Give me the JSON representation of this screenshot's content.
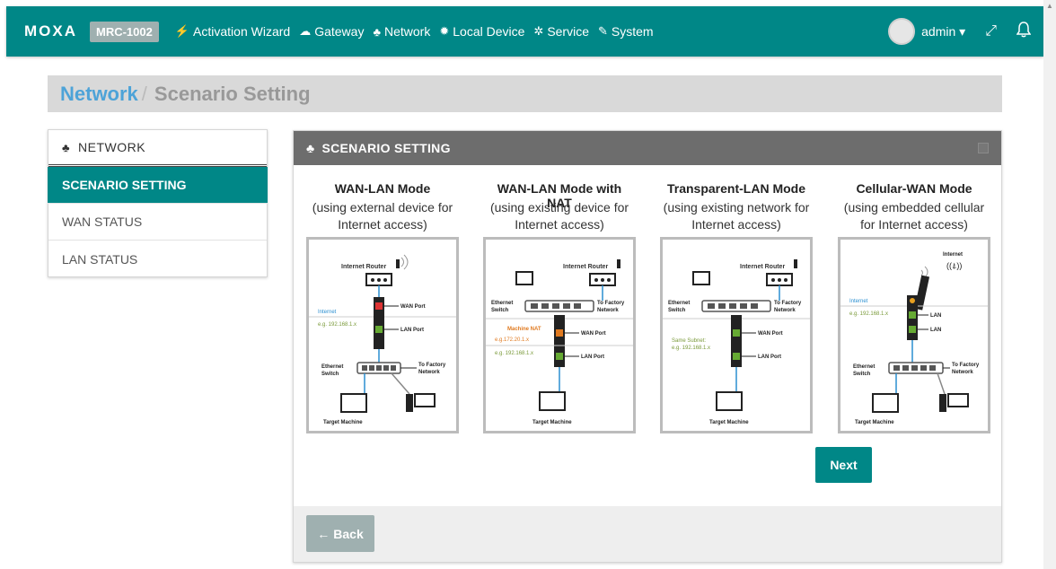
{
  "header": {
    "logo": "MOXA",
    "model": "MRC-1002",
    "nav": [
      {
        "label": "Activation Wizard",
        "icon": "wand-icon"
      },
      {
        "label": "Gateway",
        "icon": "cloud-icon"
      },
      {
        "label": "Network",
        "icon": "sitemap-icon"
      },
      {
        "label": "Local Device",
        "icon": "gear-icon"
      },
      {
        "label": "Service",
        "icon": "gears-icon"
      },
      {
        "label": "System",
        "icon": "wrench-icon"
      }
    ],
    "user": "admin"
  },
  "breadcrumb": {
    "parent": "Network",
    "separator": "/",
    "current": "Scenario Setting"
  },
  "sidebar": {
    "title": "NETWORK",
    "items": [
      {
        "label": "SCENARIO SETTING",
        "active": true
      },
      {
        "label": "WAN STATUS",
        "active": false
      },
      {
        "label": "LAN STATUS",
        "active": false
      }
    ]
  },
  "panel": {
    "title": "SCENARIO SETTING",
    "modes": [
      {
        "title": "WAN-LAN Mode",
        "subtitle_line1": "(using external device for",
        "subtitle_line2": "Internet access)"
      },
      {
        "title": "WAN-LAN Mode with NAT",
        "subtitle_line1": "(using existing device for",
        "subtitle_line2": "Internet access)"
      },
      {
        "title": "Transparent-LAN Mode",
        "subtitle_line1": "(using existing network for",
        "subtitle_line2": "Internet access)"
      },
      {
        "title": "Cellular-WAN Mode",
        "subtitle_line1": "(using embedded cellular",
        "subtitle_line2": "for Internet access)"
      }
    ],
    "next_label": "Next",
    "back_label": "Back"
  },
  "diagrams": {
    "internet_router": "Internet Router",
    "internet": "Internet",
    "wan_port": "WAN Port",
    "lan_port": "LAN Port",
    "lan": "LAN",
    "ethernet": "Ethernet",
    "switch": "Switch",
    "to_factory": "To Factory",
    "network": "Network",
    "target_machine": "Target Machine",
    "machine_nat": "Machine NAT",
    "ip_192": "e.g. 192.168.1.x",
    "ip_172": "e.g.172.20.1.x",
    "same_subnet": "Same Subnet:"
  },
  "colors": {
    "primary": "#008787",
    "breadcrumb_link": "#4da3d8",
    "panel_header": "#6d6d6d",
    "back_button": "#9fb0b0"
  }
}
